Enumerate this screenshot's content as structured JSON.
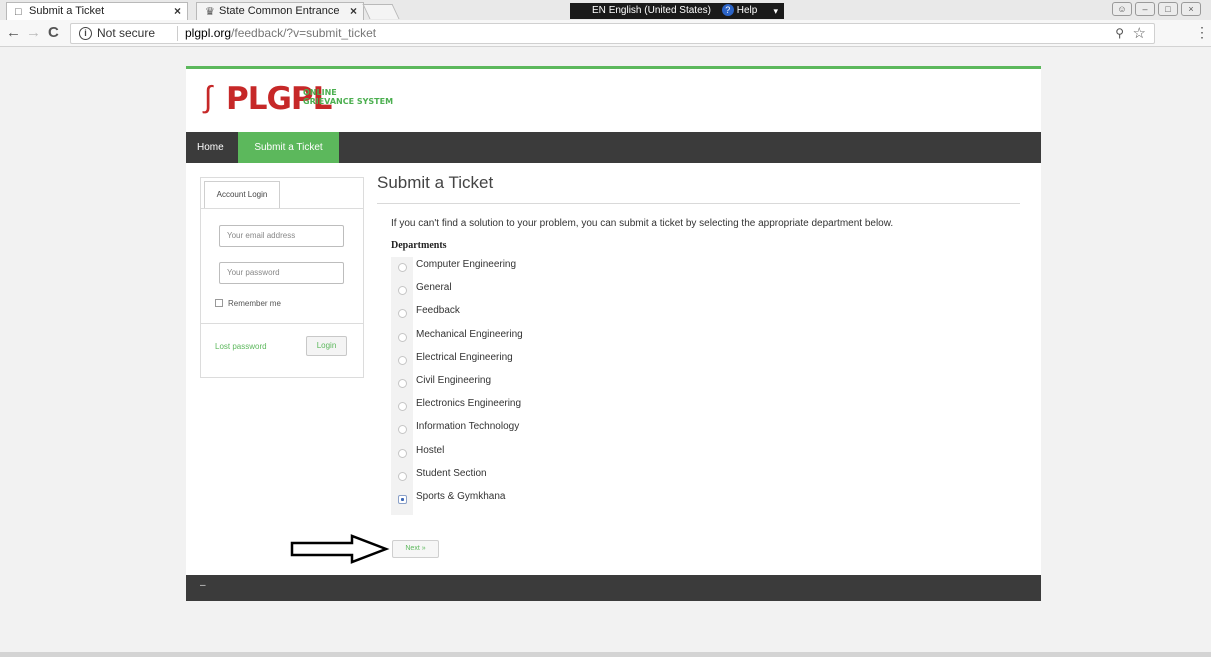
{
  "browser": {
    "tabs": [
      {
        "label": "Submit a Ticket",
        "icon": "page-icon"
      },
      {
        "label": "State Common Entrance",
        "icon": "emblem-icon"
      }
    ],
    "language_bar": {
      "code": "EN",
      "language": "English (United States)",
      "help": "Help"
    },
    "security": "Not secure",
    "url_host": "plgpl.org",
    "url_path": "/feedback/?v=submit_ticket"
  },
  "site": {
    "logo": {
      "brand": "PLGPL",
      "tagline_line1": "ONLINE",
      "tagline_line2": "GRIEVANCE SYSTEM"
    },
    "nav": [
      {
        "label": "Home"
      },
      {
        "label": "Submit a Ticket"
      }
    ],
    "colors": {
      "accent": "#5cb85c",
      "nav_bg": "#3b3b3b",
      "brand": "#c62828"
    }
  },
  "login": {
    "tab": "Account Login",
    "email_placeholder": "Your email address",
    "password_placeholder": "Your password",
    "remember": "Remember me",
    "lost_password": "Lost password",
    "button": "Login"
  },
  "main": {
    "title": "Submit a Ticket",
    "intro": "If you can't find a solution to your problem, you can submit a ticket by selecting the appropriate department below.",
    "departments_label": "Departments",
    "departments": [
      {
        "label": "Computer Engineering",
        "selected": false
      },
      {
        "label": "General",
        "selected": false
      },
      {
        "label": "Feedback",
        "selected": false
      },
      {
        "label": "Mechanical Engineering",
        "selected": false
      },
      {
        "label": "Electrical Engineering",
        "selected": false
      },
      {
        "label": "Civil Engineering",
        "selected": false
      },
      {
        "label": "Electronics Engineering",
        "selected": false
      },
      {
        "label": "Information Technology",
        "selected": false
      },
      {
        "label": "Hostel",
        "selected": false
      },
      {
        "label": "Student Section",
        "selected": false
      },
      {
        "label": "Sports & Gymkhana",
        "selected": true
      }
    ],
    "next_button": "Next »"
  },
  "footer": {
    "text": "–"
  }
}
